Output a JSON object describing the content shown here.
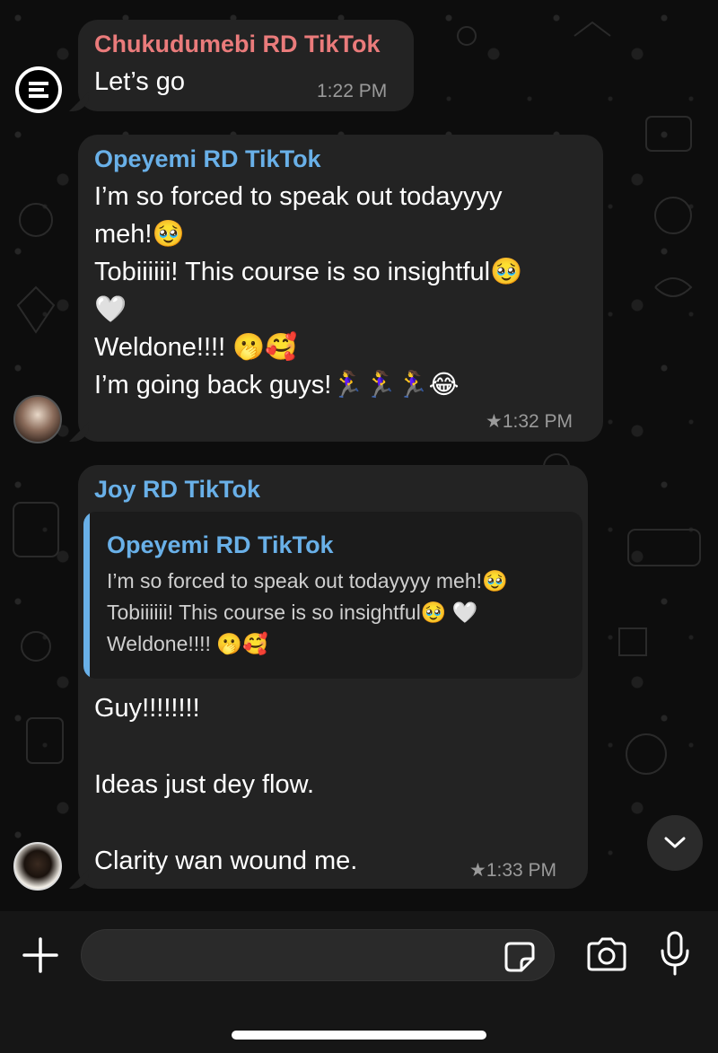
{
  "messages": [
    {
      "sender": "Chukudumebi RD TikTok",
      "sender_color": "#ea7b7b",
      "lines": [
        "Let’s go"
      ],
      "time": "1:22 PM"
    },
    {
      "sender": "Opeyemi RD TikTok",
      "sender_color": "#69b0e8",
      "lines": [
        "I’m so forced to speak out todayyyy",
        "meh!🥹",
        "Tobiiiiii! This course is so insightful🥹",
        "🤍",
        "Weldone!!!! 🫢🥰",
        "I’m going back guys!🏃‍♀️🏃‍♀️🏃‍♀️😂"
      ],
      "time": "★1:32 PM"
    },
    {
      "sender": "Joy RD TikTok",
      "sender_color": "#69b0e8",
      "reply": {
        "sender": "Opeyemi RD TikTok",
        "lines": [
          "I’m so forced to speak out todayyyy meh!🥹",
          "Tobiiiiii! This course is so insightful🥹 🤍",
          "Weldone!!!! 🫢🥰"
        ]
      },
      "lines": [
        "Guy!!!!!!!!",
        "",
        "Ideas just dey flow.",
        "",
        "Clarity wan wound me."
      ],
      "time": "★1:33 PM"
    }
  ],
  "icons": {
    "attach": "plus-icon",
    "sticker": "sticker-icon",
    "camera": "camera-icon",
    "mic": "microphone-icon",
    "scroll_down": "chevron-down-icon",
    "bot_avatar": "menu-lines-icon"
  },
  "colors": {
    "bubble": "#232323",
    "reply_bar": "#69b0e8",
    "reply_bg": "#1b1b1b"
  }
}
